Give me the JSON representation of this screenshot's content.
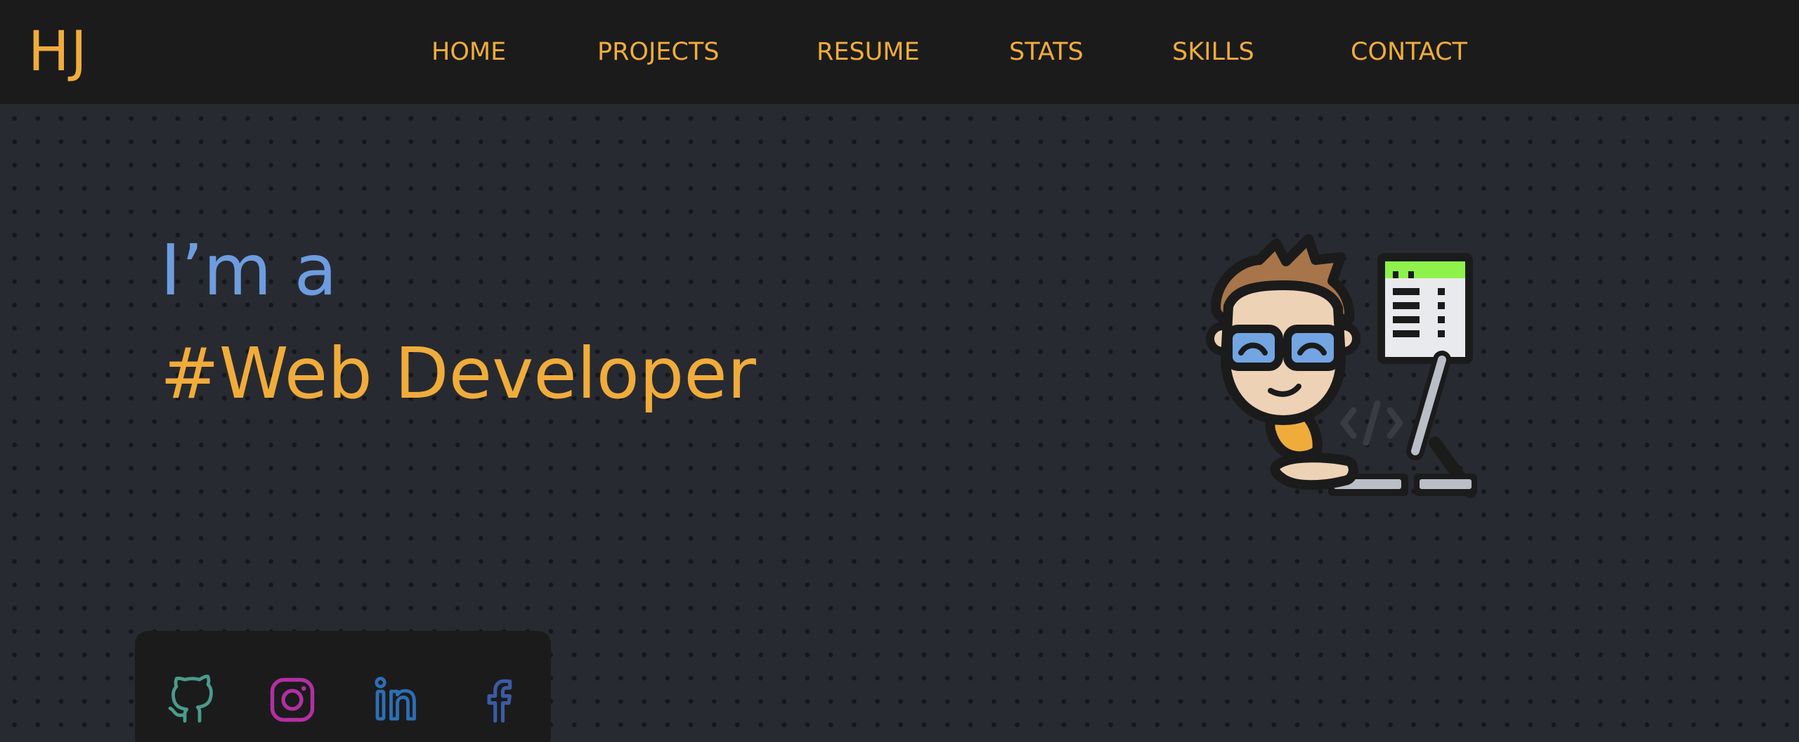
{
  "header": {
    "logo": "HJ",
    "nav": [
      {
        "label": "HOME"
      },
      {
        "label": "PROJECTS"
      },
      {
        "label": "RESUME"
      },
      {
        "label": "STATS"
      },
      {
        "label": "SKILLS"
      },
      {
        "label": "CONTACT"
      }
    ]
  },
  "hero": {
    "intro": "I’m a",
    "role": "#Web Developer",
    "illustration": "developer-at-computer-illustration"
  },
  "social": [
    {
      "icon": "github-icon",
      "color": "#4a9b8a"
    },
    {
      "icon": "instagram-icon",
      "color": "#b22fa2"
    },
    {
      "icon": "linkedin-icon",
      "color": "#2d6fb5"
    },
    {
      "icon": "facebook-icon",
      "color": "#3b5ba3"
    }
  ],
  "colors": {
    "accent": "#f0ac3b",
    "intro_blue": "#6d9de0",
    "navbar": "#1b1b1c",
    "background": "#282a31"
  }
}
